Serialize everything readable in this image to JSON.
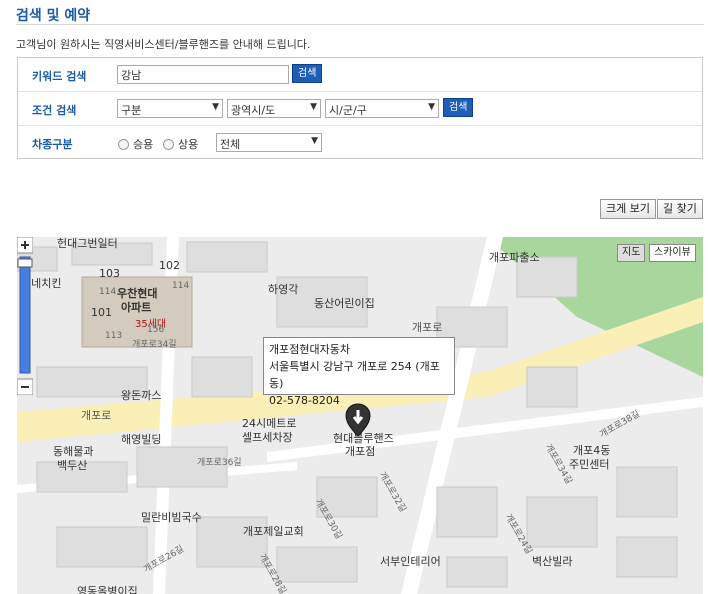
{
  "page": {
    "title": "검색 및 예약",
    "intro": "고객님이 원하시는 직영서비스센터/블루핸즈를 안내해 드립니다."
  },
  "keyword": {
    "label": "키워드 검색",
    "value": "강남",
    "button": "검색"
  },
  "condition": {
    "label": "조건 검색",
    "select1": "구분",
    "select2": "광역시/도",
    "select3": "시/군/구",
    "button": "검색"
  },
  "vehicle": {
    "label": "차종구분",
    "radio1": "승용",
    "radio2": "상용",
    "select": "전체"
  },
  "actions": {
    "enlarge": "크게 보기",
    "directions": "길 찾기"
  },
  "map": {
    "toggle_map": "지도",
    "toggle_sky": "스카이뷰",
    "labels": {
      "l_top1": "헌대그번일터",
      "l_police": "개포파출소",
      "l_nene": "네네치킨",
      "l_103": "103",
      "l_102": "102",
      "l_114a": "114",
      "l_114b": "114",
      "l_apt": "우찬현대",
      "l_apt2": "아파트",
      "l_101": "101",
      "l_35": "35세대",
      "l_113": "113",
      "l_156": "156",
      "l_hayg": "하영각",
      "l_dongsan": "동산어린이집",
      "l_gaepo_road1": "개포로",
      "l_gaepo_road2": "개포로",
      "l_gaepo34": "개포로34길",
      "l_wangdon": "왕돈까스",
      "l_24": "24시메트로",
      "l_self": "셀프세차장",
      "l_blue": "현대블루핸즈",
      "l_blue2": "개포점",
      "l_hyeyoung": "해영빌딩",
      "l_dongsa": "동해물과",
      "l_baek": "백두산",
      "l_gaepo36": "개포로36길",
      "l_gaepo38": "개포로38길",
      "l_4dong": "개포4동",
      "l_center": "주민센터",
      "l_millan": "밀란비빔국수",
      "l_gaepo_church": "개포제일교회",
      "l_gaepo32": "개포로32길",
      "l_gaepo30": "개포로30길",
      "l_gaepo28": "개포로28길",
      "l_gaepo34b": "개포로34길",
      "l_gaepo26": "개포로26길",
      "l_gaepo24": "개포로24길",
      "l_villa": "벽산빌라",
      "l_seobu": "서부인테리어",
      "l_yeong": "영동올병이집"
    },
    "popup": {
      "name": "개포점현대자동차",
      "address": "서울특별시 강남구 개포로 254 (개포동)",
      "phone": "02-578-8204"
    }
  },
  "colors": {
    "brand_blue": "#1a5ba6",
    "button_blue": "#1d5fb8",
    "road_yellow": "#fbefb8",
    "park_green": "#a9d69d"
  }
}
